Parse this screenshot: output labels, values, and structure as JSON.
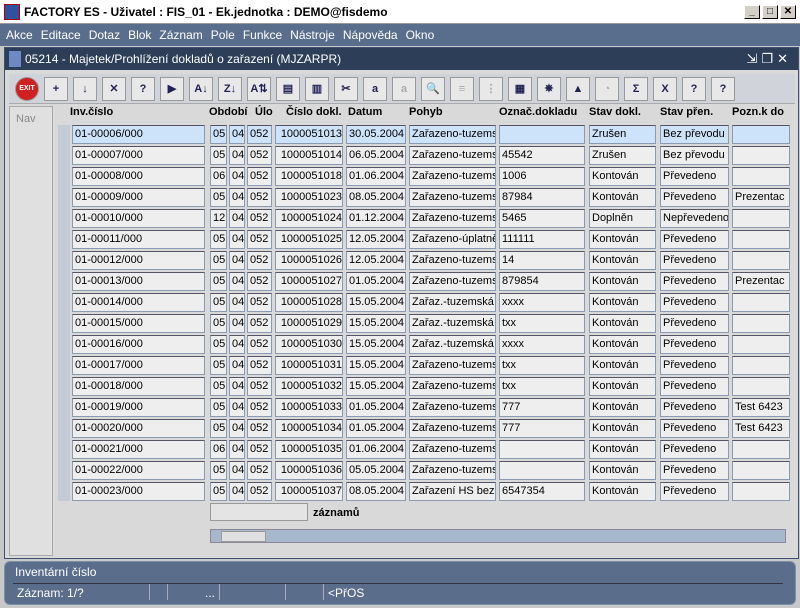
{
  "app": {
    "title": "FACTORY ES - Uživatel : FIS_01 - Ek.jednotka : DEMO@fisdemo"
  },
  "menu": [
    "Akce",
    "Editace",
    "Dotaz",
    "Blok",
    "Záznam",
    "Pole",
    "Funkce",
    "Nástroje",
    "Nápověda",
    "Okno"
  ],
  "form": {
    "title": "05214 - Majetek/Prohlížení dokladů o zařazení (MJZARPR)"
  },
  "toolbar": [
    {
      "icon": "exit-icon",
      "label": "EXIT"
    },
    {
      "icon": "insert-record-icon",
      "label": "+"
    },
    {
      "icon": "save-icon",
      "label": "↓"
    },
    {
      "icon": "delete-record-icon",
      "label": "✕"
    },
    {
      "icon": "query-enter-icon",
      "label": "?"
    },
    {
      "icon": "query-execute-icon",
      "label": "▶"
    },
    {
      "icon": "sort-asc-icon",
      "label": "A↓"
    },
    {
      "icon": "sort-desc-icon",
      "label": "Z↓"
    },
    {
      "icon": "sort-multi-icon",
      "label": "A⇅"
    },
    {
      "icon": "print-icon",
      "label": "▤"
    },
    {
      "icon": "print-setup-icon",
      "label": "▥"
    },
    {
      "icon": "cut-icon",
      "label": "✂"
    },
    {
      "icon": "copy-icon",
      "label": "a"
    },
    {
      "icon": "paste-icon",
      "label": "a",
      "disabled": true
    },
    {
      "icon": "find-icon",
      "label": "🔍"
    },
    {
      "icon": "indent-icon",
      "label": "≡",
      "disabled": true
    },
    {
      "icon": "columns-icon",
      "label": "⋮",
      "disabled": true
    },
    {
      "icon": "calculator-icon",
      "label": "▦"
    },
    {
      "icon": "wheel-icon",
      "label": "✵"
    },
    {
      "icon": "eye-icon",
      "label": "▲"
    },
    {
      "icon": "clock-icon",
      "label": "◔",
      "disabled": true
    },
    {
      "icon": "sum-icon",
      "label": "Σ"
    },
    {
      "icon": "excel-icon",
      "label": "X"
    },
    {
      "icon": "help-icon",
      "label": "?"
    },
    {
      "icon": "help-context-icon",
      "label": "?"
    }
  ],
  "nav_label": "Nav",
  "columns": [
    "Inv.číslo",
    "Období",
    "Úlo",
    "Číslo dokl.",
    "Datum",
    "Pohyb",
    "Označ.dokladu",
    "Stav dokl.",
    "Stav přen.",
    "Pozn.k do"
  ],
  "rows": [
    [
      "01-00006/000",
      "05",
      "04",
      "052",
      "1000051013",
      "30.05.2004",
      "Zařazeno-tuzems",
      "",
      "Zrušen",
      "Bez převodu",
      ""
    ],
    [
      "01-00007/000",
      "05",
      "04",
      "052",
      "1000051014",
      "06.05.2004",
      "Zařazeno-tuzems",
      "45542",
      "Zrušen",
      "Bez převodu",
      ""
    ],
    [
      "01-00008/000",
      "06",
      "04",
      "052",
      "1000051018",
      "01.06.2004",
      "Zařazeno-tuzems",
      "1006",
      "Kontován",
      "Převedeno",
      ""
    ],
    [
      "01-00009/000",
      "05",
      "04",
      "052",
      "1000051023",
      "08.05.2004",
      "Zařazeno-tuzems",
      "87984",
      "Kontován",
      "Převedeno",
      "Prezentac"
    ],
    [
      "01-00010/000",
      "12",
      "04",
      "052",
      "1000051024",
      "01.12.2004",
      "Zařazeno-tuzems",
      "5465",
      "Doplněn",
      "Nepřevedeno",
      ""
    ],
    [
      "01-00011/000",
      "05",
      "04",
      "052",
      "1000051025",
      "12.05.2004",
      "Zařazeno-úplatně",
      "111111",
      "Kontován",
      "Převedeno",
      ""
    ],
    [
      "01-00012/000",
      "05",
      "04",
      "052",
      "1000051026",
      "12.05.2004",
      "Zařazeno-tuzems",
      "14",
      "Kontován",
      "Převedeno",
      ""
    ],
    [
      "01-00013/000",
      "05",
      "04",
      "052",
      "1000051027",
      "01.05.2004",
      "Zařazeno-tuzems",
      "879854",
      "Kontován",
      "Převedeno",
      "Prezentac"
    ],
    [
      "01-00014/000",
      "05",
      "04",
      "052",
      "1000051028",
      "15.05.2004",
      "Zařaz.-tuzemská",
      "xxxx",
      "Kontován",
      "Převedeno",
      ""
    ],
    [
      "01-00015/000",
      "05",
      "04",
      "052",
      "1000051029",
      "15.05.2004",
      "Zařaz.-tuzemská",
      "txx",
      "Kontován",
      "Převedeno",
      ""
    ],
    [
      "01-00016/000",
      "05",
      "04",
      "052",
      "1000051030",
      "15.05.2004",
      "Zařaz.-tuzemská",
      "xxxx",
      "Kontován",
      "Převedeno",
      ""
    ],
    [
      "01-00017/000",
      "05",
      "04",
      "052",
      "1000051031",
      "15.05.2004",
      "Zařazeno-tuzems",
      "txx",
      "Kontován",
      "Převedeno",
      ""
    ],
    [
      "01-00018/000",
      "05",
      "04",
      "052",
      "1000051032",
      "15.05.2004",
      "Zařazeno-tuzems",
      "txx",
      "Kontován",
      "Převedeno",
      ""
    ],
    [
      "01-00019/000",
      "05",
      "04",
      "052",
      "1000051033",
      "01.05.2004",
      "Zařazeno-tuzems",
      "777",
      "Kontován",
      "Převedeno",
      "Test 6423"
    ],
    [
      "01-00020/000",
      "05",
      "04",
      "052",
      "1000051034",
      "01.05.2004",
      "Zařazeno-tuzems",
      "777",
      "Kontován",
      "Převedeno",
      "Test 6423"
    ],
    [
      "01-00021/000",
      "06",
      "04",
      "052",
      "1000051035",
      "01.06.2004",
      "Zařazeno-tuzems",
      "",
      "Kontován",
      "Převedeno",
      ""
    ],
    [
      "01-00022/000",
      "05",
      "04",
      "052",
      "1000051036",
      "05.05.2004",
      "Zařazeno-tuzems",
      "",
      "Kontován",
      "Převedeno",
      ""
    ],
    [
      "01-00023/000",
      "05",
      "04",
      "052",
      "1000051037",
      "08.05.2004",
      "Zařazení HS bezp",
      "6547354",
      "Kontován",
      "Převedeno",
      ""
    ]
  ],
  "count_label": "záznamů",
  "status": {
    "hint": "Inventární číslo",
    "record": "Záznam: 1/?",
    "seg3": "...",
    "mode": "<PřOS"
  }
}
